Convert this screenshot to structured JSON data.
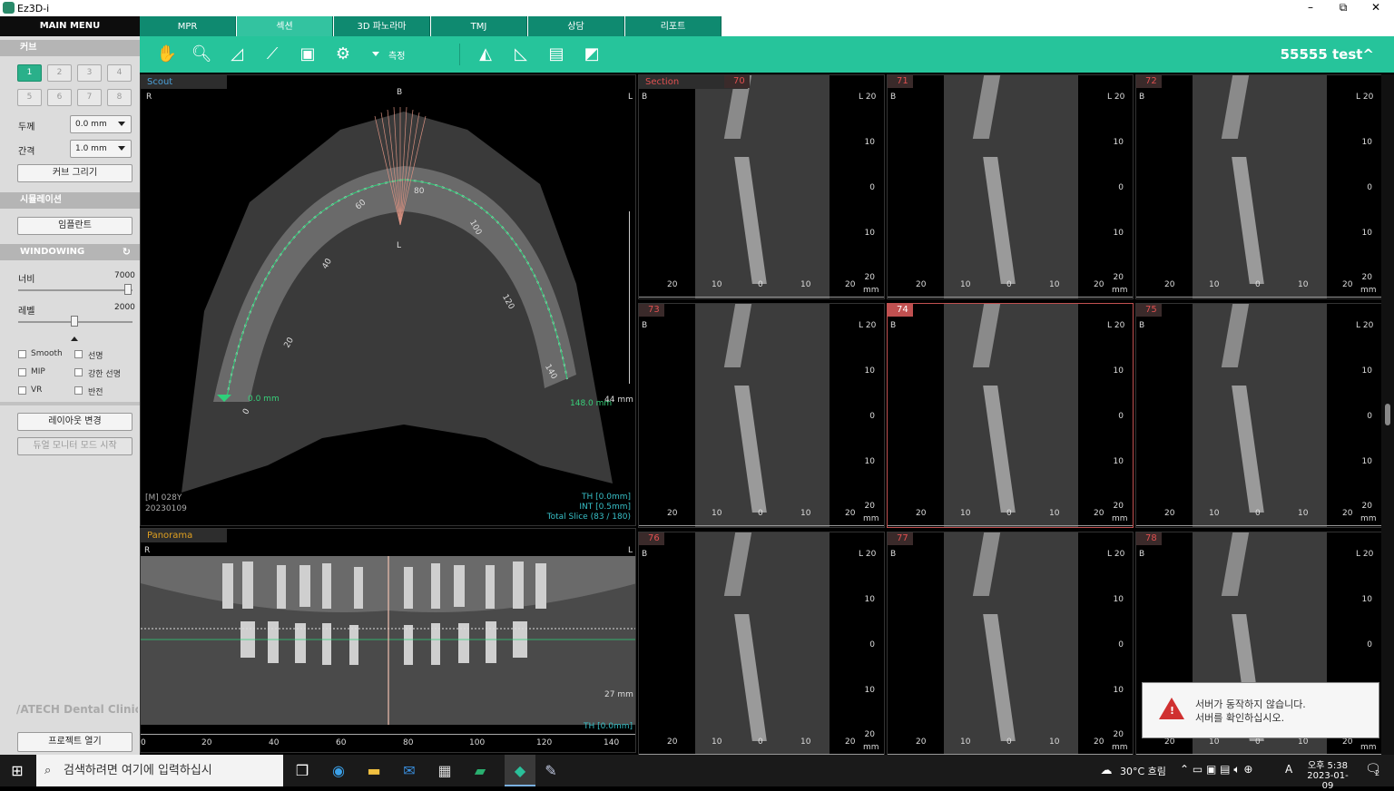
{
  "window": {
    "title": "Ez3D-i",
    "minimize": "–",
    "restore": "⧉",
    "close": "✕"
  },
  "left_panel": {
    "main_menu": "MAIN MENU",
    "curve_section": "커브",
    "curve_numbers": [
      "1",
      "2",
      "3",
      "4",
      "5",
      "6",
      "7",
      "8"
    ],
    "thickness_label": "두께",
    "thickness_value": "0.0 mm",
    "interval_label": "간격",
    "interval_value": "1.0 mm",
    "draw_curve": "커브 그리기",
    "simulation_section": "시뮬레이션",
    "implant": "임플란트",
    "windowing_section": "WINDOWING",
    "width_label": "너비",
    "width_value": "7000",
    "width_level": 1.0,
    "level_label": "레벨",
    "level_value": "2000",
    "level_level": 0.5,
    "checks": [
      "Smooth",
      "선명",
      "MIP",
      "강한 선명",
      "VR",
      "반전"
    ],
    "layout_change": "레이아웃 변경",
    "dual_monitor": "듀얼 모니터 모드 시작",
    "brand": "/ATECH Dental Clinic",
    "open_project": "프로젝트 열기"
  },
  "tabs": [
    "MPR",
    "섹션",
    "3D 파노라마",
    "TMJ",
    "상담",
    "리포트"
  ],
  "toolbar": {
    "measure": "측정",
    "patient": "55555 test^"
  },
  "scout": {
    "header": "Scout",
    "r": "R",
    "l": "L",
    "b": "B",
    "start_mm": "0.0 mm",
    "end_mm": "148.0 mm",
    "scale_mm": "44 mm",
    "curve_labels": [
      "0",
      "20",
      "40",
      "60",
      "80",
      "100",
      "120",
      "140"
    ],
    "patient_info": "[M] 028Y",
    "date": "20230109",
    "th": "TH [0.0mm]",
    "int": "INT [0.5mm]",
    "slice": "Total Slice (83 / 180)"
  },
  "panorama": {
    "header": "Panorama",
    "r": "R",
    "l": "L",
    "scale_mm": "27 mm",
    "th": "TH [0.0mm]",
    "x_ticks": [
      "0",
      "20",
      "40",
      "60",
      "80",
      "100",
      "120",
      "140"
    ]
  },
  "sections": {
    "header": "Section",
    "numbers": [
      "70",
      "71",
      "72",
      "73",
      "74",
      "75",
      "76",
      "77",
      "78"
    ],
    "selected": "74",
    "b": "B",
    "l20": "L 20",
    "y_ticks": [
      "10",
      "0",
      "10",
      "20"
    ],
    "x_ticks": [
      "20",
      "10",
      "0",
      "10",
      "20"
    ],
    "unit": "mm"
  },
  "notification": {
    "line1": "서버가 동작하지 않습니다.",
    "line2": "서버를 확인하십시오."
  },
  "taskbar": {
    "search_placeholder": "검색하려면 여기에 입력하십시",
    "weather": "30°C 흐림",
    "ime": "A",
    "time": "오후 5:38",
    "date": "2023-01-09",
    "notif_count": "2"
  }
}
